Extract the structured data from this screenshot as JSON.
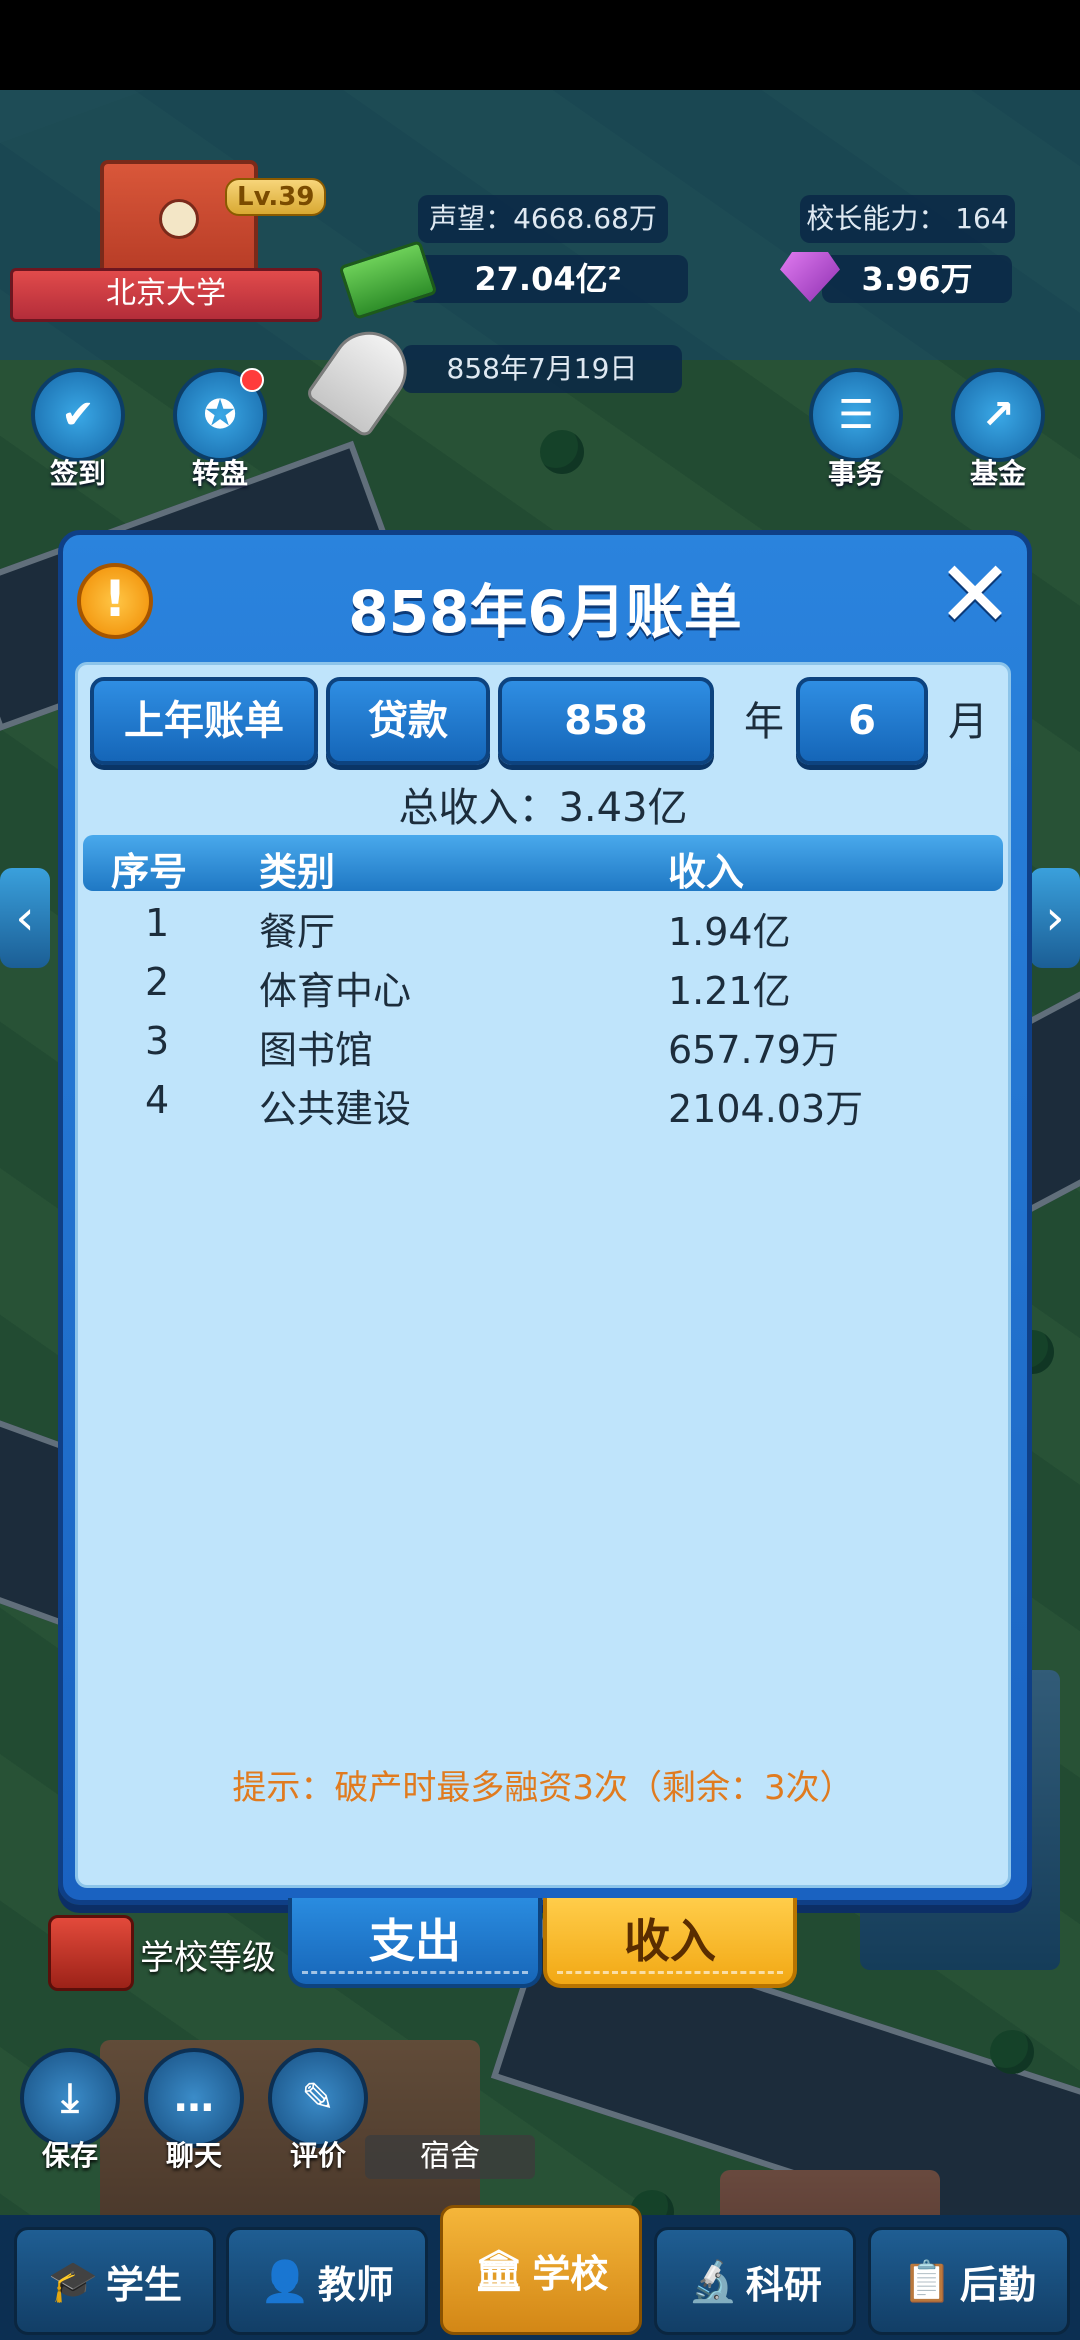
{
  "hud": {
    "school_name": "北京大学",
    "level": "Lv.39",
    "reputation": "声望：4668.68万",
    "principal_ability": "校长能力：  164",
    "money": "27.04亿²",
    "gems": "3.96万",
    "date": "858年7月19日"
  },
  "side_buttons": {
    "checkin": "签到",
    "wheel": "转盘",
    "affairs": "事务",
    "fund": "基金"
  },
  "dialog": {
    "title": "858年6月账单",
    "toolbar": {
      "last_year_bill": "上年账单",
      "loan": "贷款",
      "year_value": "858",
      "year_unit": "年",
      "month_value": "6",
      "month_unit": "月"
    },
    "total_income": "总收入：3.43亿",
    "table": {
      "headers": [
        "序号",
        "类别",
        "收入"
      ],
      "rows": [
        {
          "no": "1",
          "category": "餐厅",
          "income": "1.94亿"
        },
        {
          "no": "2",
          "category": "体育中心",
          "income": "1.21亿"
        },
        {
          "no": "3",
          "category": "图书馆",
          "income": "657.79万"
        },
        {
          "no": "4",
          "category": "公共建设",
          "income": "2104.03万"
        }
      ]
    },
    "tip": "提示：破产时最多融资3次（剩余：3次）"
  },
  "tabs": {
    "expense": "支出",
    "income": "收入"
  },
  "lower_hud": {
    "school_level": "学校等级",
    "save": "保存",
    "chat": "聊天",
    "review": "评价",
    "dorm": "宿舍"
  },
  "bottom_nav": {
    "students": "学生",
    "teachers": "教师",
    "school": "学校",
    "research": "科研",
    "logistics": "后勤"
  },
  "colors": {
    "dialog_blue": "#1a62c1",
    "panel_bg": "#bfe4fb",
    "income_tab": "#f2a814",
    "tip_orange": "#e07b1f"
  }
}
